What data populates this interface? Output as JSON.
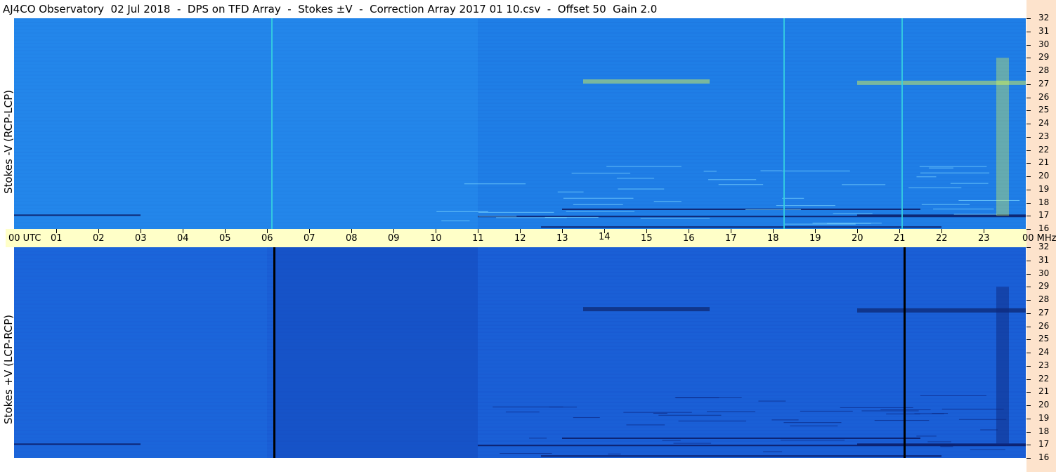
{
  "title": "AJ4CO Observatory  02 Jul 2018  -  DPS on TFD Array  -  Stokes ±V  -  Correction Array 2017 01 10.csv  -  Offset 50  Gain 2.0",
  "panels": {
    "top": {
      "ylabel": "Stokes -V (RCP-LCP)"
    },
    "bottom": {
      "ylabel": "Stokes +V (LCP-RCP)"
    }
  },
  "x_axis": {
    "labels": [
      "00  UTC",
      "01",
      "02",
      "03",
      "04",
      "05",
      "06",
      "07",
      "08",
      "09",
      "10",
      "11",
      "12",
      "13",
      "14",
      "15",
      "16",
      "17",
      "18",
      "19",
      "20",
      "21",
      "22",
      "23",
      "00 MHz"
    ]
  },
  "y_axis": {
    "labels": [
      "32",
      "31",
      "30",
      "29",
      "28",
      "27",
      "26",
      "25",
      "24",
      "23",
      "22",
      "21",
      "20",
      "19",
      "18",
      "17",
      "16"
    ]
  },
  "colors": {
    "background_top": "#1f7ee6",
    "background_bottom": "#1a5fd6",
    "time_band": "#ffffc8",
    "side_strip": "#fde3cc",
    "dark_line": "#000000",
    "bright_line": "#35d0e0",
    "yellow_burst": "#e8ff4a"
  },
  "chart_data": [
    {
      "type": "heatmap",
      "name": "Stokes -V (RCP-LCP)",
      "x": {
        "unit": "UTC hour",
        "range": [
          0,
          24
        ]
      },
      "y": {
        "unit": "MHz",
        "range": [
          16,
          32
        ]
      },
      "features": {
        "bright_vertical_lines_hours": [
          6.1,
          18.25,
          21.05
        ],
        "dark_horizontal_bands_mhz": [
          17.0,
          16.0
        ],
        "bright_emission_regions": [
          {
            "hours": [
              13.5,
              16.5
            ],
            "mhz": 27.2
          },
          {
            "hours": [
              20.0,
              24.0
            ],
            "mhz": 27.1
          },
          {
            "hours": [
              23.3,
              23.6
            ],
            "mhz": [
              17,
              29
            ]
          }
        ]
      }
    },
    {
      "type": "heatmap",
      "name": "Stokes +V (LCP-RCP)",
      "x": {
        "unit": "UTC hour",
        "range": [
          0,
          24
        ]
      },
      "y": {
        "unit": "MHz",
        "range": [
          16,
          32
        ]
      },
      "features": {
        "black_vertical_lines_hours": [
          6.15,
          21.1
        ],
        "dark_emission_regions": [
          {
            "hours": [
              13.5,
              16.5
            ],
            "mhz": 27.3
          },
          {
            "hours": [
              20.0,
              24.0
            ],
            "mhz": 27.2
          }
        ]
      }
    }
  ]
}
